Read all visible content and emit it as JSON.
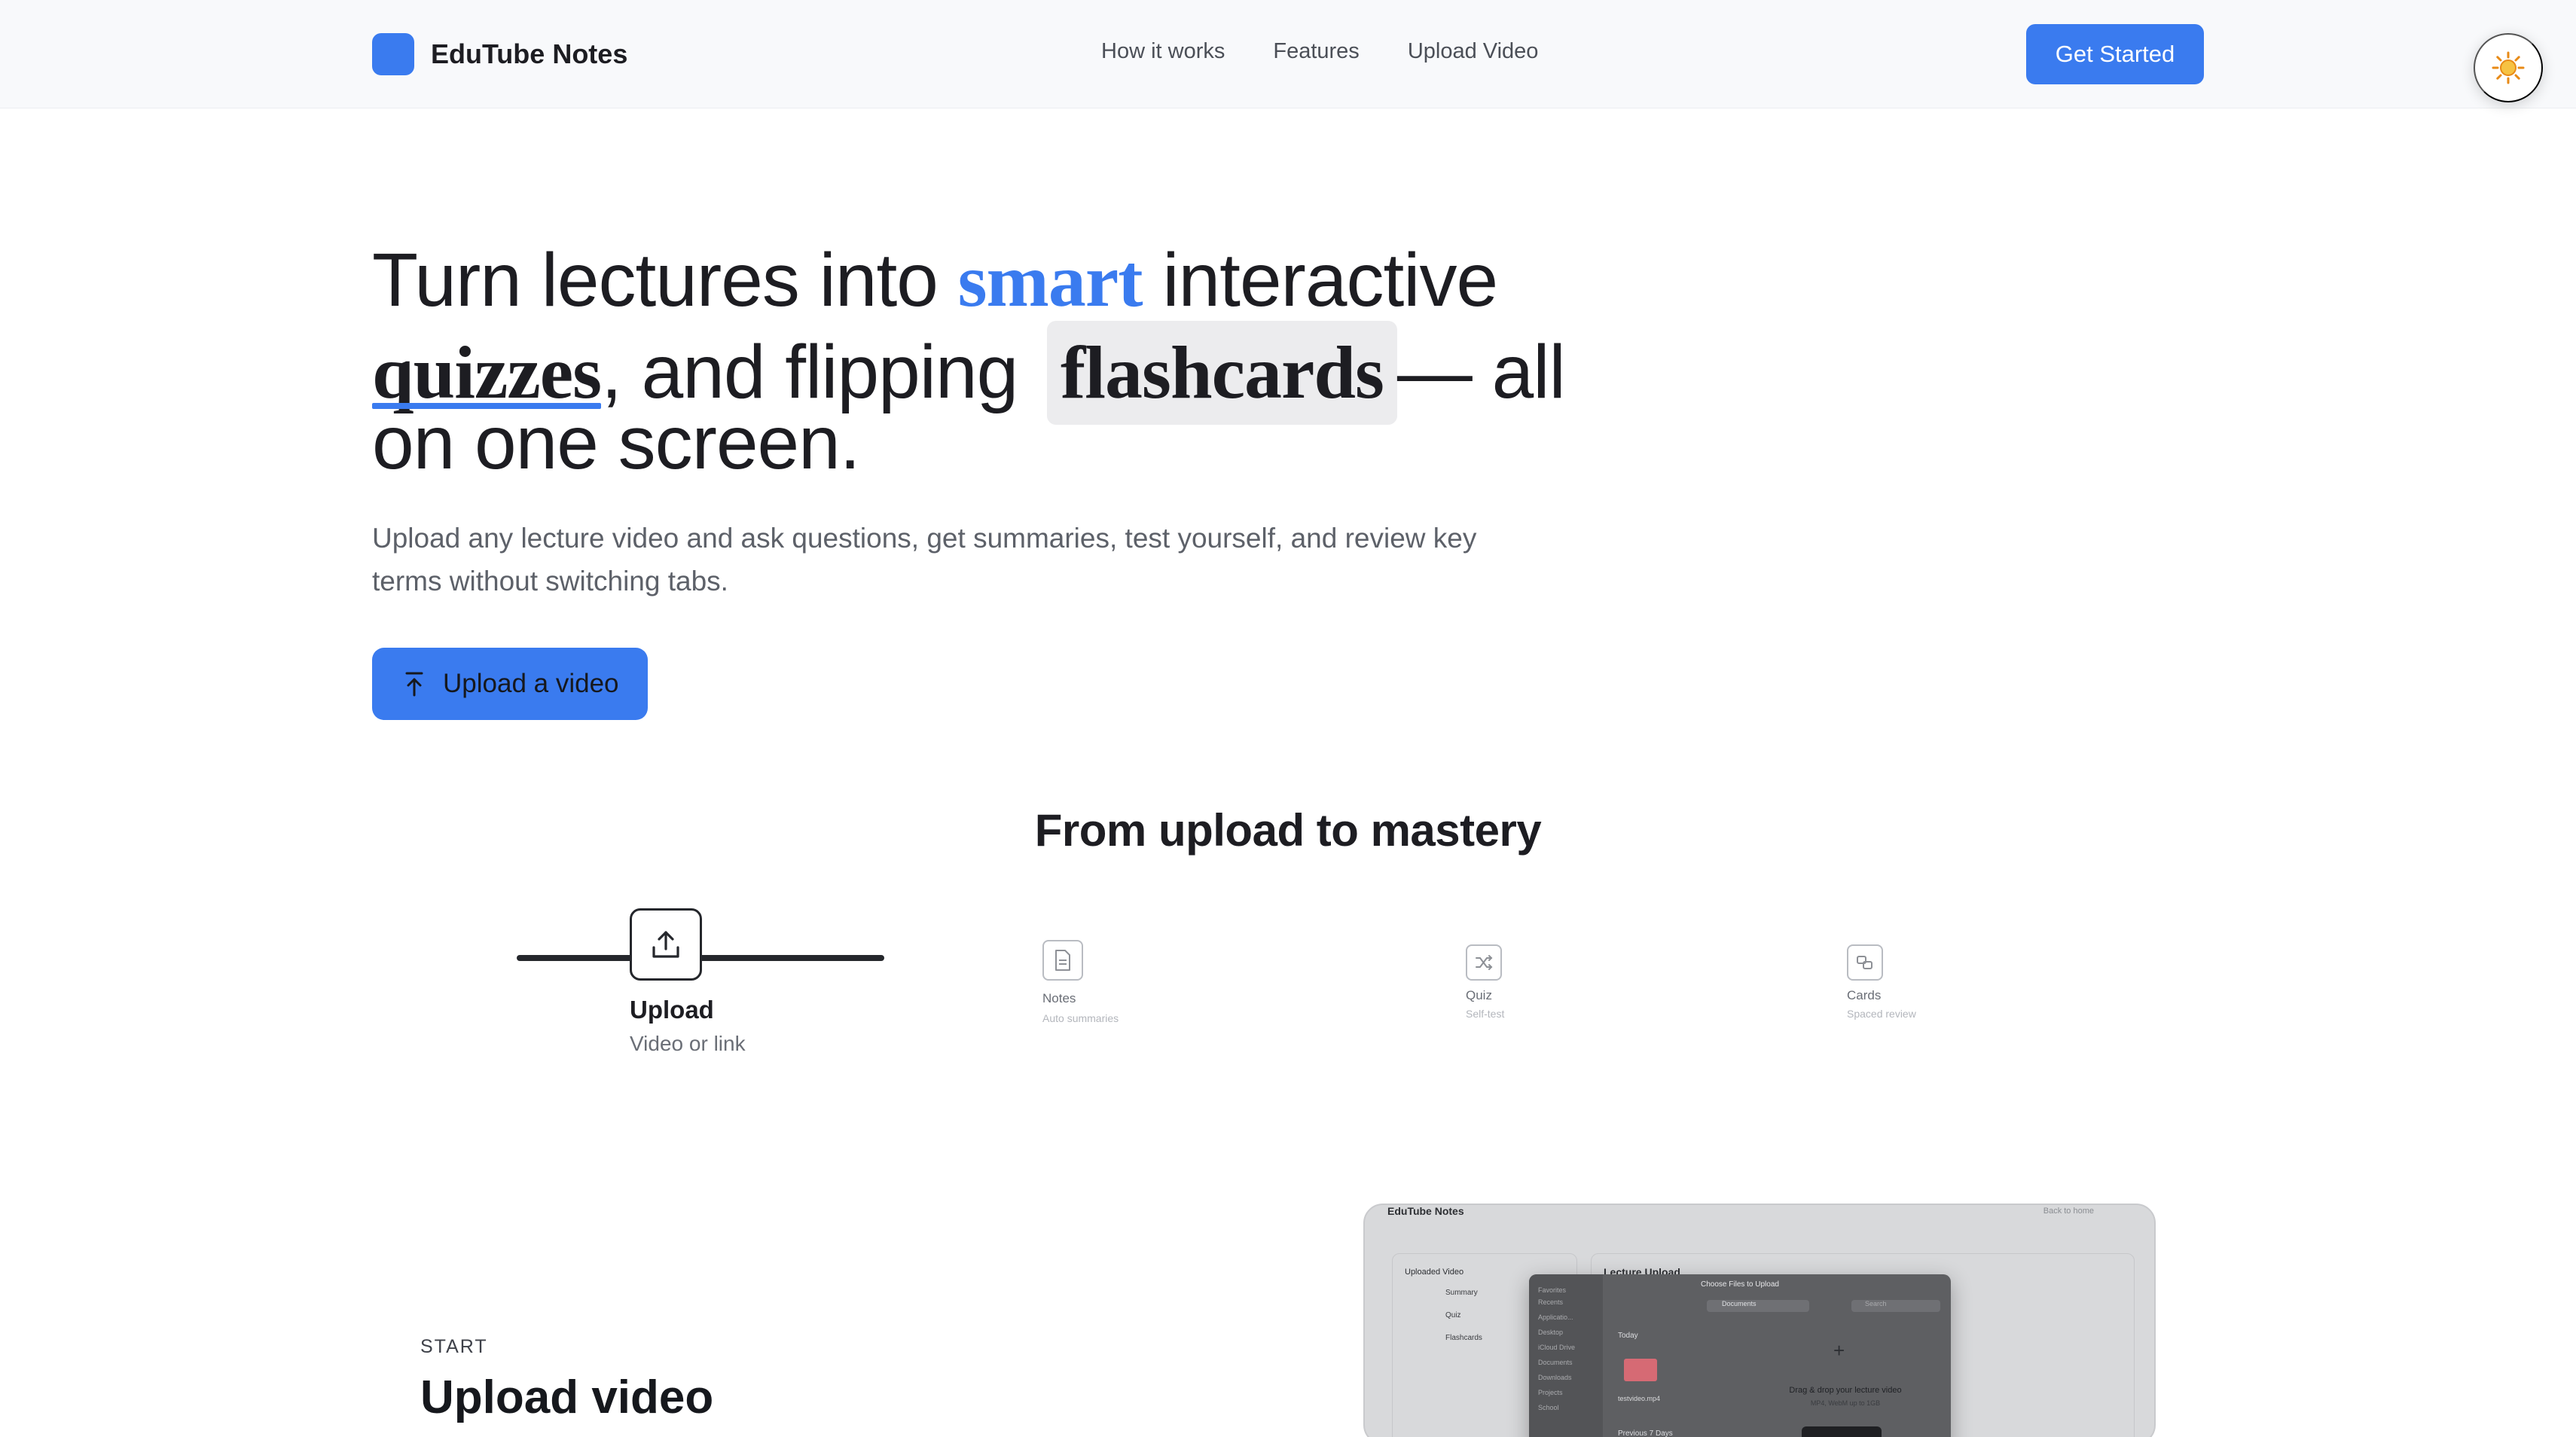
{
  "header": {
    "brand": "EduTube Notes",
    "nav": [
      "How it works",
      "Features",
      "Upload Video"
    ],
    "cta": "Get Started",
    "theme_icon": "sun-icon"
  },
  "hero": {
    "line1_a": "Turn lectures into ",
    "line1_accent": "smart",
    "line1_b": " interactive",
    "line2_word": "quizzes",
    "line2_mid": ", and flipping ",
    "line2_highlight": "flashcards",
    "line2_end": "— all",
    "line3": "on one screen.",
    "subtitle": "Upload any lecture video and ask questions, get summaries, test yourself, and review key terms without switching tabs.",
    "upload_button": "Upload a video"
  },
  "steps": {
    "title": "From upload to mastery",
    "items": [
      {
        "label": "Upload",
        "sub": "Video or link",
        "icon": "upload-icon"
      },
      {
        "label": "Notes",
        "sub": "Auto summaries",
        "icon": "document-icon"
      },
      {
        "label": "Quiz",
        "sub": "Self-test",
        "icon": "shuffle-icon"
      },
      {
        "label": "Cards",
        "sub": "Spaced review",
        "icon": "cards-icon"
      }
    ]
  },
  "feature": {
    "eyebrow": "START",
    "title": "Upload video"
  },
  "preview": {
    "brand": "EduTube Notes",
    "back": "Back to home",
    "sidebar": {
      "header": "Uploaded Video",
      "items": [
        "Summary",
        "Quiz",
        "Flashcards"
      ]
    },
    "main_title": "Lecture Upload",
    "dialog": {
      "title": "Choose Files to Upload",
      "favorites": [
        "Favorites",
        "Recents",
        "Applicatio...",
        "Desktop",
        "iCloud Drive",
        "Documents",
        "Downloads",
        "Projects",
        "School"
      ],
      "location": "Documents",
      "search": "Search",
      "today": "Today",
      "file": "testvideo.mp4",
      "drop_text": "Drag & drop your lecture video",
      "drop_sub": "MP4, WebM up to 1GB",
      "previous": "Previous 7 Days"
    }
  },
  "colors": {
    "accent": "#3a7bef",
    "text": "#1d1d22",
    "muted": "#5d6169",
    "header_bg": "#f8f9fb"
  }
}
